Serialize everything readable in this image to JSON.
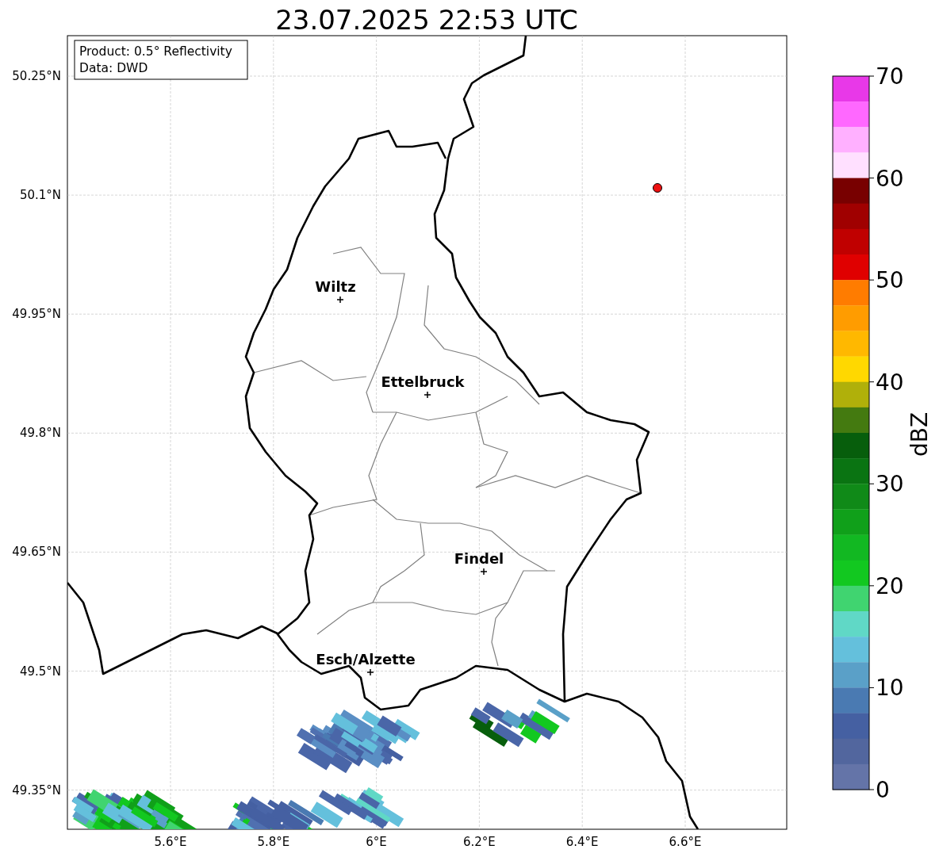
{
  "title": "23.07.2025 22:53 UTC",
  "info_box": [
    "Product: 0.5° Reflectivity",
    "Data: DWD"
  ],
  "lat_labels": [
    "50.25°N",
    "50.1°N",
    "49.95°N",
    "49.8°N",
    "49.65°N",
    "49.5°N",
    "49.35°N"
  ],
  "lon_labels": [
    "5.6°E",
    "5.8°E",
    "6°E",
    "6.2°E",
    "6.4°E",
    "6.6°E"
  ],
  "cities": [
    {
      "label": "Wiltz"
    },
    {
      "label": "Ettelbruck"
    },
    {
      "label": "Findel"
    },
    {
      "label": "Esch/Alzette"
    }
  ],
  "colorbar": {
    "label": "dBZ",
    "ticks": [
      "70",
      "60",
      "50",
      "40",
      "30",
      "20",
      "10",
      "0"
    ],
    "bands": [
      {
        "color": "#e838e8"
      },
      {
        "color": "#ff68ff"
      },
      {
        "color": "#ffb0ff"
      },
      {
        "color": "#ffe0ff"
      },
      {
        "color": "#780000"
      },
      {
        "color": "#a00000"
      },
      {
        "color": "#c00000"
      },
      {
        "color": "#e00000"
      },
      {
        "color": "#ff7c00"
      },
      {
        "color": "#ff9c00"
      },
      {
        "color": "#ffb800"
      },
      {
        "color": "#ffd800"
      },
      {
        "color": "#b0b00a"
      },
      {
        "color": "#447a10"
      },
      {
        "color": "#075e0c"
      },
      {
        "color": "#0a7412"
      },
      {
        "color": "#108a18"
      },
      {
        "color": "#10a01a"
      },
      {
        "color": "#12b822"
      },
      {
        "color": "#12c820"
      },
      {
        "color": "#40d470"
      },
      {
        "color": "#60d8c6"
      },
      {
        "color": "#64c0dc"
      },
      {
        "color": "#5aa0c8"
      },
      {
        "color": "#4a7ab2"
      },
      {
        "color": "#4560a2"
      },
      {
        "color": "#52669e"
      },
      {
        "color": "#6474a8"
      }
    ]
  }
}
